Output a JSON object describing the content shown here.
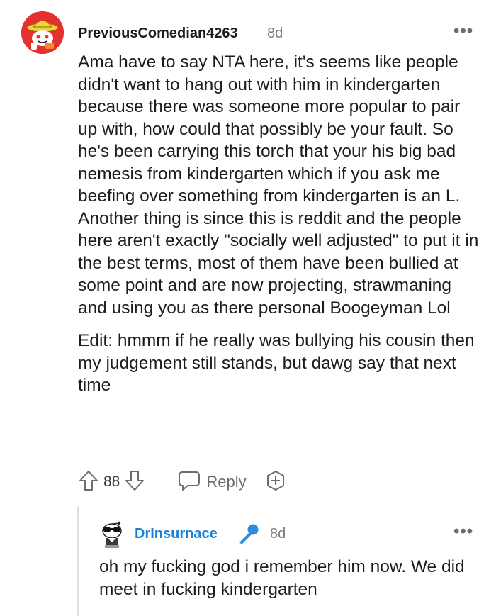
{
  "comment": {
    "username": "PreviousComedian4263",
    "time": "8d",
    "more": "•••",
    "body": "Ama have to say NTA here, it's seems like people didn't want to hang out with him in kindergarten because there was someone more popular to pair up with, how could that possibly be your fault. So he's been carrying this torch that your his big bad nemesis from kindergarten which if you ask me beefing over something from kindergarten is an L. Another thing is since this is reddit and the people here aren't exactly \"socially well adjusted\" to put it in the best terms, most of them have been bullied at some point and are now projecting, strawmaning and using you as there personal Boogeyman Lol",
    "edit": "Edit: hmmm if he really was bullying his cousin then my judgement still stands, but dawg say that next time",
    "votes": "88",
    "reply_label": "Reply"
  },
  "reply": {
    "username": "DrInsurnace",
    "time": "8d",
    "more": "•••",
    "body": "oh my fucking god i remember him now. We did meet in fucking kindergarten"
  },
  "colors": {
    "accent_blue": "#1d80d8",
    "avatar_red": "#e4312f",
    "muted": "#7c7c7c"
  },
  "icons": [
    "snoo-avatar-icon",
    "upvote-icon",
    "downvote-icon",
    "reply-bubble-icon",
    "award-icon",
    "snoo-sunglasses-avatar-icon",
    "microphone-icon",
    "more-options-icon"
  ]
}
